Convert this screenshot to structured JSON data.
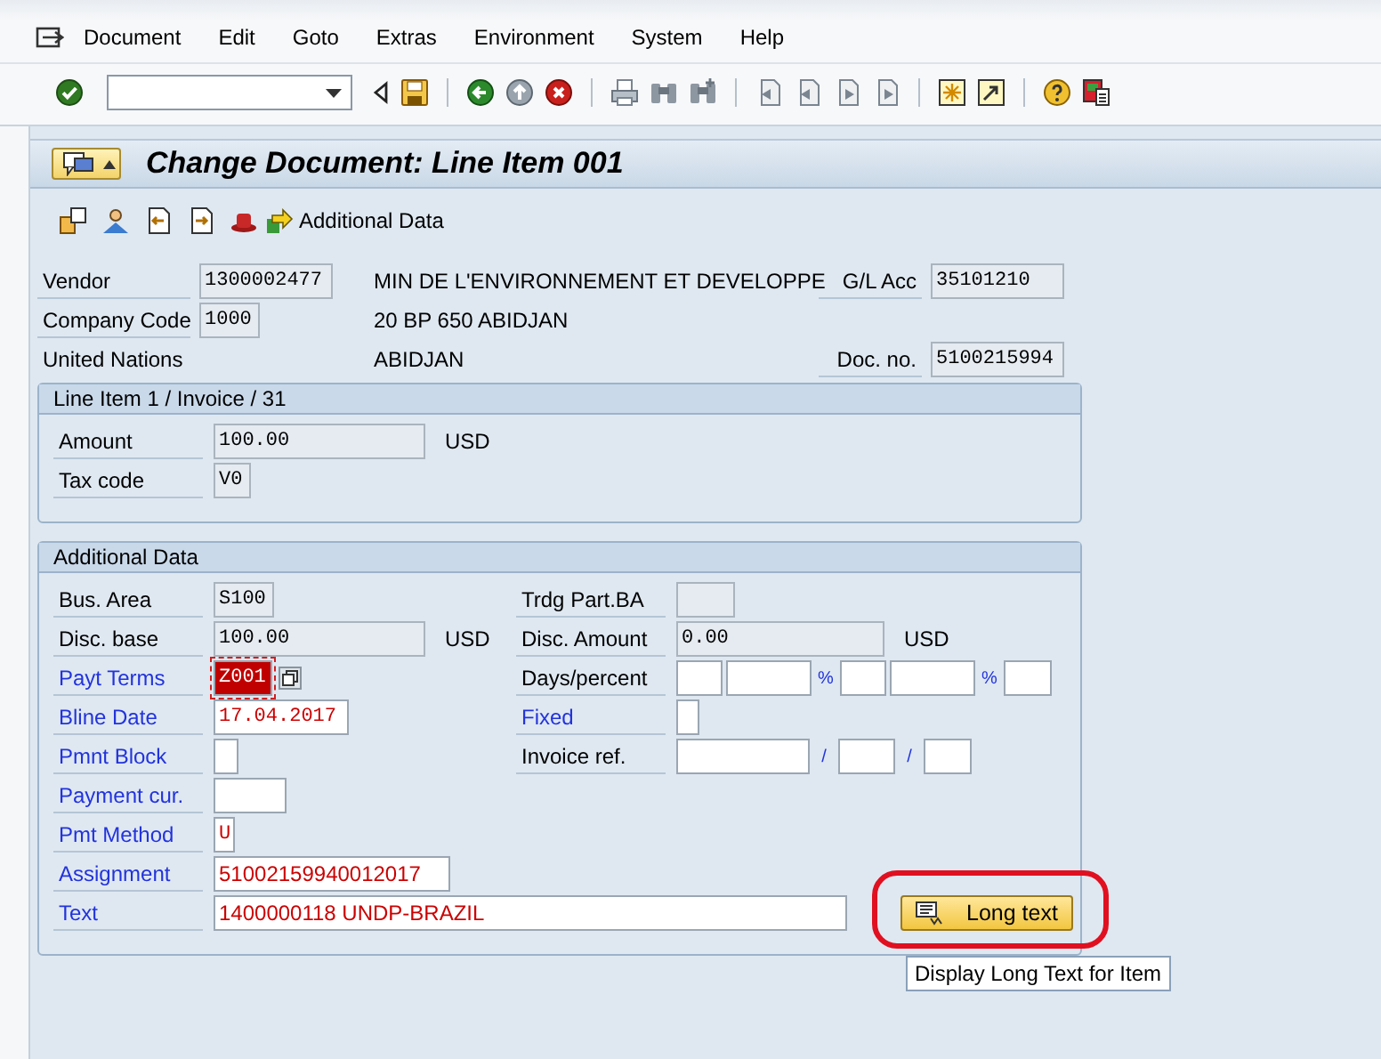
{
  "menu": [
    "Document",
    "Edit",
    "Goto",
    "Extras",
    "Environment",
    "System",
    "Help"
  ],
  "title": "Change Document: Line Item 001",
  "app_toolbar": {
    "button_label": "Additional Data"
  },
  "header": [
    {
      "label": "Vendor",
      "field": {
        "value": "1300002477",
        "readonly": true
      },
      "text": "MIN DE L'ENVIRONNEMENT ET DEVELOPPE",
      "right_label": "G/L Acc",
      "right_field": {
        "value": "35101210",
        "readonly": true
      }
    },
    {
      "label": "Company Code",
      "field": {
        "value": "1000",
        "readonly": true
      },
      "text": "20 BP 650 ABIDJAN"
    },
    {
      "plain_label": "United Nations",
      "text": "ABIDJAN",
      "right_label": "Doc. no.",
      "right_field": {
        "value": "5100215994",
        "readonly": true
      }
    }
  ],
  "groups": [
    {
      "title": "Line Item 1 / Invoice / 31",
      "rows": [
        {
          "label": "Amount",
          "color": "#000000",
          "fields": [
            {
              "kind": "field",
              "value": "100.00",
              "readonly": true,
              "focused": false
            }
          ],
          "unit": "USD"
        },
        {
          "label": "Tax code",
          "color": "#000000",
          "fields": [
            {
              "kind": "field",
              "value": "V0",
              "readonly": true,
              "focused": false
            }
          ]
        }
      ]
    },
    {
      "title": "Additional Data",
      "rows": [
        {
          "label": "Bus. Area",
          "color": "#000000",
          "fields": [
            {
              "kind": "field",
              "value": "S100",
              "readonly": true,
              "focused": false
            }
          ],
          "right": {
            "label": "Trdg Part.BA",
            "color": "#000000",
            "fields": [
              {
                "kind": "field",
                "readonly": true,
                "focused": false
              }
            ]
          }
        },
        {
          "label": "Disc. base",
          "color": "#000000",
          "fields": [
            {
              "kind": "field",
              "value": "100.00",
              "readonly": true,
              "focused": false
            }
          ],
          "unit": "USD",
          "right": {
            "label": "Disc. Amount",
            "color": "#000000",
            "fields": [
              {
                "kind": "field",
                "value": "0.00",
                "readonly": true,
                "focused": false
              }
            ],
            "unit": "USD"
          }
        },
        {
          "label": "Payt Terms",
          "color": "#2233dd",
          "fields": [
            {
              "kind": "field",
              "value": "Z001",
              "readonly": false,
              "focused": true
            }
          ],
          "right": {
            "label": "Days/percent",
            "color": "#000000",
            "fields": [
              {
                "kind": "field",
                "readonly": false,
                "focused": false
              },
              {
                "kind": "field",
                "readonly": false,
                "focused": false
              },
              {
                "kind": "separator",
                "text": "%"
              },
              {
                "kind": "field",
                "readonly": false,
                "focused": false
              },
              {
                "kind": "field",
                "readonly": false,
                "focused": false
              },
              {
                "kind": "separator",
                "text": "%"
              },
              {
                "kind": "field",
                "readonly": false,
                "focused": false
              }
            ]
          }
        },
        {
          "label": "Bline Date",
          "color": "#2233dd",
          "fields": [
            {
              "kind": "field",
              "value": "17.04.2017",
              "readonly": false,
              "focused": false,
              "color": "#cc0000"
            }
          ],
          "right": {
            "label": "Fixed",
            "color": "#2233dd",
            "fields": [
              {
                "kind": "field",
                "readonly": false,
                "focused": false
              }
            ]
          }
        },
        {
          "label": "Pmnt Block",
          "color": "#2233dd",
          "fields": [
            {
              "kind": "field",
              "readonly": false,
              "focused": false
            }
          ],
          "right": {
            "label": "Invoice ref.",
            "color": "#000000",
            "fields": [
              {
                "kind": "field",
                "readonly": false,
                "focused": false
              },
              {
                "kind": "separator",
                "text": "/"
              },
              {
                "kind": "field",
                "readonly": false,
                "focused": false
              },
              {
                "kind": "separator",
                "text": "/"
              },
              {
                "kind": "field",
                "readonly": false,
                "focused": false
              }
            ]
          }
        },
        {
          "label": "Payment cur.",
          "color": "#2233dd",
          "fields": [
            {
              "kind": "field",
              "readonly": false,
              "focused": false
            }
          ]
        },
        {
          "label": "Pmt Method",
          "color": "#2233dd",
          "fields": [
            {
              "kind": "field",
              "value": "U",
              "readonly": false,
              "focused": false,
              "color": "#cc0000"
            }
          ]
        },
        {
          "label": "Assignment",
          "color": "#2233dd",
          "fields": [
            {
              "kind": "field",
              "value": "51002159940012017",
              "readonly": false,
              "focused": false,
              "color": "#cc0000"
            }
          ]
        },
        {
          "label": "Text",
          "color": "#2233dd",
          "fields": [
            {
              "kind": "field",
              "value": "1400000118 UNDP-BRAZIL",
              "readonly": false,
              "focused": false,
              "color": "#cc0000"
            }
          ],
          "button": {
            "label": "Long text"
          }
        }
      ]
    }
  ],
  "tooltip": "Display Long Text for Item"
}
